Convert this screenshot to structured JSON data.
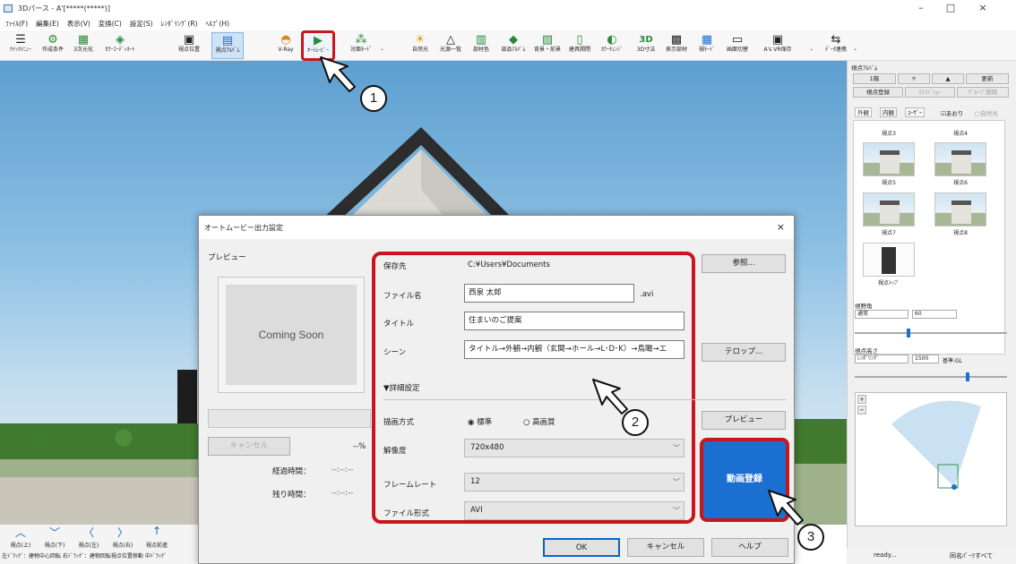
{
  "window": {
    "title": "3Dパース - A'[*****(*****)]",
    "minimize": "–",
    "maximize": "□",
    "close": "×"
  },
  "menu": [
    "ﾌｧｲﾙ(F)",
    "編集(E)",
    "表示(V)",
    "変換(C)",
    "設定(S)",
    "ﾚﾝﾀﾞﾘﾝｸﾞ(R)",
    "ﾍﾙﾌﾟ(H)"
  ],
  "toolbar": [
    {
      "label": "ｸｲｯｸﾒﾆｭｰ",
      "icon": "menu-icon",
      "glyph": "☰"
    },
    {
      "label": "作成条件",
      "icon": "conditions-icon",
      "glyph": "⚙"
    },
    {
      "label": "3次元化",
      "icon": "3d-icon",
      "glyph": "▦"
    },
    {
      "label": "ｶﾗｰｺｰﾃﾞｨﾈｰﾄ",
      "icon": "color-coordinate-icon",
      "glyph": "◈"
    },
    {
      "label": "視点位置",
      "icon": "camera-icon",
      "glyph": "▣"
    },
    {
      "label": "視点ｱﾙﾊﾞﾑ",
      "icon": "view-album-icon",
      "glyph": "▤"
    },
    {
      "label": "V-Ray",
      "icon": "vray-icon",
      "glyph": "◓"
    },
    {
      "label": "ｵｰﾄﾑｰﾋﾞｰ",
      "icon": "auto-movie-icon",
      "glyph": "▶"
    },
    {
      "label": "対面ﾓｰﾄﾞ",
      "icon": "face-mode-icon",
      "glyph": "⁂"
    },
    {
      "label": "自然光",
      "icon": "sunlight-icon",
      "glyph": "☀"
    },
    {
      "label": "光源一覧",
      "icon": "light-list-icon",
      "glyph": "△"
    },
    {
      "label": "部材色",
      "icon": "material-color-icon",
      "glyph": "▥"
    },
    {
      "label": "部品ｱﾙﾊﾞﾑ",
      "icon": "parts-album-icon",
      "glyph": "◆"
    },
    {
      "label": "背景・前景",
      "icon": "background-icon",
      "glyph": "▧"
    },
    {
      "label": "建具開閉",
      "icon": "door-icon",
      "glyph": "▯"
    },
    {
      "label": "ｶﾗｰﾁｪﾝｼﾞ",
      "icon": "color-change-icon",
      "glyph": "◐"
    },
    {
      "label": "3D寸法",
      "icon": "3d-dimension-icon",
      "glyph": "3D"
    },
    {
      "label": "表示部材",
      "icon": "display-parts-icon",
      "glyph": "▩"
    },
    {
      "label": "視ﾓｰﾄﾞ",
      "icon": "view-mode-icon",
      "glyph": "▦"
    },
    {
      "label": "画面切替",
      "icon": "screen-switch-icon",
      "glyph": "▭"
    },
    {
      "label": "A's VR保存",
      "icon": "vr-save-icon",
      "glyph": "▣"
    },
    {
      "label": "ﾃﾞｰﾀ連携",
      "icon": "data-link-icon",
      "glyph": "⇆"
    }
  ],
  "view_nav": {
    "arrows": [
      "︿",
      "﹀",
      "〈",
      "〉",
      "↑"
    ],
    "labels": [
      "視点(上)",
      "視点(下)",
      "視点(左)",
      "視点(右)",
      "視点前進"
    ],
    "hint": "左ﾄﾞﾗｯｸﾞ：建物中心回転  右ﾄﾞﾗｯｸﾞ：建物回転視点位置移動  中ﾄﾞﾗｯｸﾞ"
  },
  "status": {
    "state": "ready...",
    "mode": "同名ﾊﾟｰﾂすべて"
  },
  "side_panel": {
    "title": "視点ｱﾙﾊﾞﾑ",
    "floor": "1階",
    "down": "▼",
    "up": "▲",
    "refresh": "更新",
    "register": "視点登録",
    "slideshow": "ｽﾗｲﾄﾞｼｮｰ",
    "delete": "ｸﾞﾙｰﾌﾟ削除",
    "tabs": [
      "外観",
      "内観",
      "ﾕｰｻﾞｰ"
    ],
    "check1": "☑あおり",
    "check2": "□自然光",
    "thumbs": [
      "視点3",
      "視点4",
      "視点5",
      "視点6",
      "視点7",
      "視点8",
      "視点ﾄｯﾌﾟ"
    ],
    "fov_label": "視野角",
    "fov_mode": "通常",
    "fov_value": "60",
    "height_label": "視点高さ",
    "height_mode": "ﾚﾝﾀﾞﾘﾝｸﾞ",
    "height_value": "1500",
    "height_unit": "基準:GL",
    "zoom_in": "+",
    "zoom_out": "−"
  },
  "dialog": {
    "title": "オートムービー出力設定",
    "close": "×",
    "preview_label": "プレビュー",
    "preview_placeholder": "Coming Soon",
    "cancel_progress": "キャンセル",
    "percent": "--%",
    "elapsed_label": "経過時間：",
    "elapsed_value": "--:--:--",
    "remaining_label": "残り時間：",
    "remaining_value": "--:--:--",
    "save_to_label": "保存先",
    "save_to_value": "C:¥Users¥Documents",
    "browse": "参照...",
    "file_name_label": "ファイル名",
    "file_name_value": "西泉  太郎",
    "extension": ".avi",
    "title_label": "タイトル",
    "title_value": "住まいのご提案",
    "scene_label": "シーン",
    "scene_value": "タイトル→外観→内観（玄関→ホール→L･D･K）→鳥瞰→エ",
    "telop": "テロップ...",
    "details": "▼詳細設定",
    "render_label": "描画方式",
    "render_standard": "◉ 標準",
    "render_hq": "○ 高画質",
    "preview_button": "プレビュー",
    "resolution_label": "解像度",
    "resolution_value": "720x480",
    "framerate_label": "フレームレート",
    "framerate_value": "12",
    "format_label": "ファイル形式",
    "format_value": "AVI",
    "register_video": "動画登録",
    "ok": "OK",
    "cancel": "キャンセル",
    "help": "ヘルプ",
    "chevron": "﹀"
  },
  "callouts": [
    "1",
    "2",
    "3"
  ],
  "colors": {
    "highlight": "#c8161d",
    "primary_button": "#1b6fd1",
    "active_tool": "#cfe3f7"
  }
}
